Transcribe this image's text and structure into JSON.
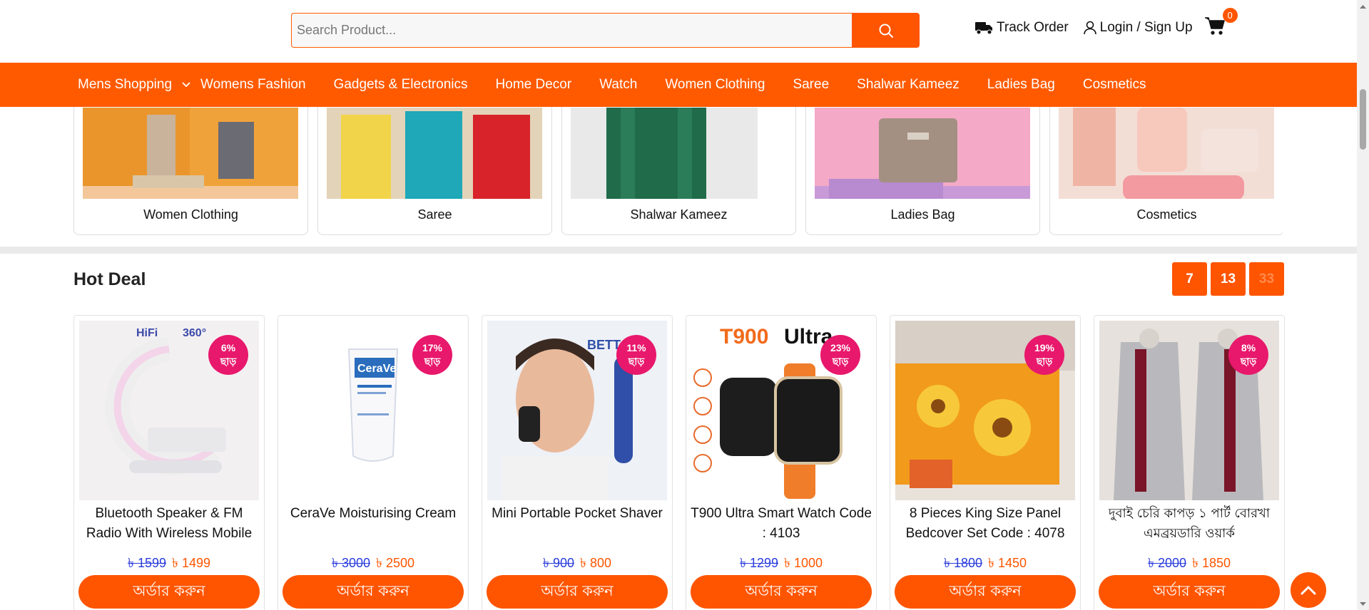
{
  "search": {
    "placeholder": "Search Product..."
  },
  "header": {
    "track_order": "Track Order",
    "login": "Login / Sign Up",
    "cart_count": "0"
  },
  "nav": {
    "items": [
      "Mens Shopping",
      "Womens Fashion",
      "Gadgets & Electronics",
      "Home Decor",
      "Watch",
      "Women Clothing",
      "Saree",
      "Shalwar Kameez",
      "Ladies Bag",
      "Cosmetics"
    ]
  },
  "categories": [
    {
      "label": "Women Clothing"
    },
    {
      "label": "Saree"
    },
    {
      "label": "Shalwar Kameez"
    },
    {
      "label": "Ladies Bag"
    },
    {
      "label": "Cosmetics"
    }
  ],
  "hot_deal": {
    "title": "Hot Deal",
    "timer": [
      "7",
      "13",
      "33"
    ]
  },
  "products": [
    {
      "name": "Bluetooth Speaker & FM Radio With Wireless Mobile",
      "discount": "6%",
      "discount_word": "ছাড়",
      "old_price": "৳ 1599",
      "new_price": "৳ 1499",
      "button": "অর্ডার করুন"
    },
    {
      "name": "CeraVe Moisturising Cream",
      "discount": "17%",
      "discount_word": "ছাড়",
      "old_price": "৳ 3000",
      "new_price": "৳ 2500",
      "button": "অর্ডার করুন"
    },
    {
      "name": "Mini Portable Pocket Shaver",
      "discount": "11%",
      "discount_word": "ছাড়",
      "old_price": "৳ 900",
      "new_price": "৳ 800",
      "button": "অর্ডার করুন"
    },
    {
      "name": "T900 Ultra Smart Watch Code : 4103",
      "discount": "23%",
      "discount_word": "ছাড়",
      "old_price": "৳ 1299",
      "new_price": "৳ 1000",
      "button": "অর্ডার করুন"
    },
    {
      "name": "8 Pieces King Size Panel Bedcover Set Code : 4078",
      "discount": "19%",
      "discount_word": "ছাড়",
      "old_price": "৳ 1800",
      "new_price": "৳ 1450",
      "button": "অর্ডার করুন"
    },
    {
      "name": "দুবাই চেরি কাপড় ১ পার্ট বোরখা এমব্রয়ডারি ওয়ার্ক",
      "discount": "8%",
      "discount_word": "ছাড়",
      "old_price": "৳ 2000",
      "new_price": "৳ 1850",
      "button": "অর্ডার করুন"
    }
  ],
  "colors": {
    "brand": "#ff5500",
    "nav": "#ff5a00",
    "badge": "#e8186c",
    "old_price": "#2a3cdc"
  },
  "icons": [
    "search-icon",
    "truck-icon",
    "user-icon",
    "cart-icon",
    "chevron-down-icon",
    "arrow-up-icon"
  ]
}
